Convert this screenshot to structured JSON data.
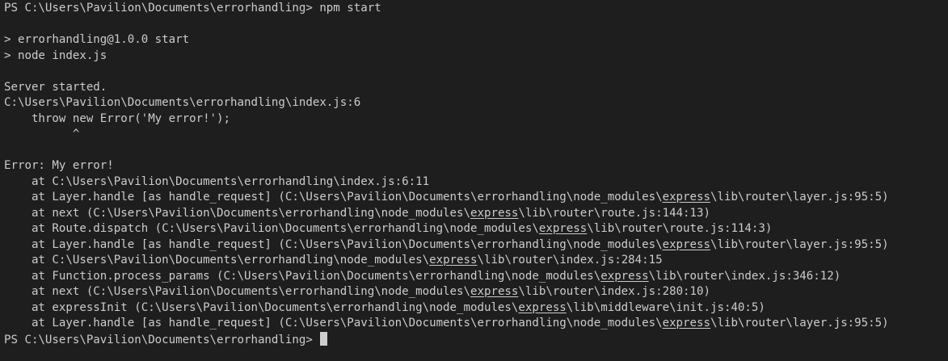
{
  "terminal": {
    "prompt_line": "PS C:\\Users\\Pavilion\\Documents\\errorhandling> npm start",
    "script_line": "> errorhandling@1.0.0 start",
    "node_line": "> node index.js",
    "server_started": "Server started.",
    "source_location": "C:\\Users\\Pavilion\\Documents\\errorhandling\\index.js:6",
    "throw_line": "    throw new Error('My error!');",
    "caret_line": "          ^",
    "error_message": "Error: My error!",
    "stack": {
      "l1": "    at C:\\Users\\Pavilion\\Documents\\errorhandling\\index.js:6:11",
      "l2_pre": "    at Layer.handle [as handle_request] (C:\\Users\\Pavilion\\Documents\\errorhandling\\node_modules\\",
      "l2_u": "express",
      "l2_post": "\\lib\\router\\layer.js:95:5)",
      "l3_pre": "    at next (C:\\Users\\Pavilion\\Documents\\errorhandling\\node_modules\\",
      "l3_u": "express",
      "l3_post": "\\lib\\router\\route.js:144:13)",
      "l4_pre": "    at Route.dispatch (C:\\Users\\Pavilion\\Documents\\errorhandling\\node_modules\\",
      "l4_u": "express",
      "l4_post": "\\lib\\router\\route.js:114:3)",
      "l5_pre": "    at Layer.handle [as handle_request] (C:\\Users\\Pavilion\\Documents\\errorhandling\\node_modules\\",
      "l5_u": "express",
      "l5_post": "\\lib\\router\\layer.js:95:5)",
      "l6_pre": "    at C:\\Users\\Pavilion\\Documents\\errorhandling\\node_modules\\",
      "l6_u": "express",
      "l6_post": "\\lib\\router\\index.js:284:15",
      "l7_pre": "    at Function.process_params (C:\\Users\\Pavilion\\Documents\\errorhandling\\node_modules\\",
      "l7_u": "express",
      "l7_post": "\\lib\\router\\index.js:346:12)",
      "l8_pre": "    at next (C:\\Users\\Pavilion\\Documents\\errorhandling\\node_modules\\",
      "l8_u": "express",
      "l8_post": "\\lib\\router\\index.js:280:10)",
      "l9_pre": "    at expressInit (C:\\Users\\Pavilion\\Documents\\errorhandling\\node_modules\\",
      "l9_u": "express",
      "l9_post": "\\lib\\middleware\\init.js:40:5)",
      "l10_pre": "    at Layer.handle [as handle_request] (C:\\Users\\Pavilion\\Documents\\errorhandling\\node_modules\\",
      "l10_u": "express",
      "l10_post": "\\lib\\router\\layer.js:95:5)"
    },
    "final_prompt": "PS C:\\Users\\Pavilion\\Documents\\errorhandling> "
  },
  "colors": {
    "background": "#1e1e1e",
    "foreground": "#cccccc"
  }
}
